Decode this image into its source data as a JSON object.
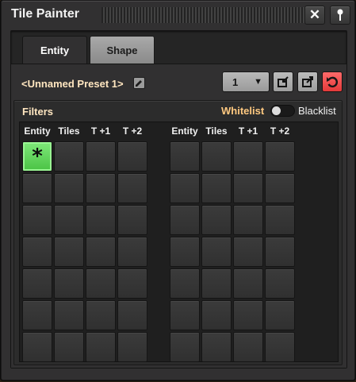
{
  "window": {
    "title": "Tile Painter",
    "close_icon": "close-icon",
    "pin_icon": "pin-icon"
  },
  "tabs": [
    {
      "label": "Entity",
      "active": true
    },
    {
      "label": "Shape",
      "active": false
    }
  ],
  "preset": {
    "name": "<Unnamed Preset 1>",
    "selected_number": "1",
    "edit_icon": "pencil-icon",
    "import_icon": "import-icon",
    "export_icon": "export-icon",
    "reset_icon": "reset-icon"
  },
  "filters": {
    "title": "Filters",
    "whitelist_label": "Whitelist",
    "blacklist_label": "Blacklist",
    "mode": "whitelist",
    "left_columns": [
      "Entity",
      "Tiles",
      "T +1",
      "T +2"
    ],
    "right_columns": [
      "Entity",
      "Tiles",
      "T +1",
      "T +2"
    ],
    "rows": 7,
    "filled_slot": {
      "group": "left",
      "row": 0,
      "col": 0,
      "glyph": "*"
    }
  },
  "colors": {
    "accent": "#ffc980",
    "filled_slot": "#6fe06a",
    "reset_button": "#ef4b4b"
  }
}
